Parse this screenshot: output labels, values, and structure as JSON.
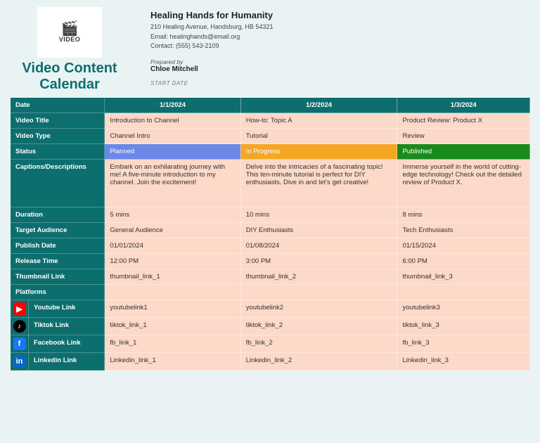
{
  "title_line1": "Video Content",
  "title_line2": "Calendar",
  "logo_word": "VIDEO",
  "org": {
    "name": "Healing Hands for Humanity",
    "address": "210 Healing Avenue, Handsburg, HB 54321",
    "email": "Email: healinghands@email.org",
    "contact": "Contact: (555) 543-2109"
  },
  "prepared_by_label": "Prepared by",
  "prepared_by": "Chloe Mitchell",
  "start_date_label": "START DATE",
  "labels": {
    "date": "Date",
    "video_title": "Video Title",
    "video_type": "Video Type",
    "status": "Status",
    "captions": "Captions/Descriptions",
    "duration": "Duration",
    "target": "Target Audience",
    "publish": "Publish Date",
    "release": "Release Time",
    "thumb": "Thumbnail Link",
    "platforms": "Platforms",
    "youtube": "Youtube Link",
    "tiktok": "Tiktok Link",
    "facebook": "Facebook Link",
    "linkedin": "Linkedin Link"
  },
  "cols": [
    {
      "date": "1/1/2024",
      "title": "Introduction to Channel",
      "type": "Channel Intro",
      "status": "Planned",
      "status_class": "planned",
      "caption": "Embark on an exhilarating journey with me! A five-minute introduction to my channel. Join the excitement!",
      "duration": "5 mins",
      "target": "General Audience",
      "publish": "01/01/2024",
      "release": "12:00 PM",
      "thumb": "thumbnail_link_1",
      "youtube": "youtubelink1",
      "tiktok": "tiktok_link_1",
      "facebook": "fb_link_1",
      "linkedin": "Linkedin_link_1"
    },
    {
      "date": "1/2/2024",
      "title": "How-to: Topic A",
      "type": "Tutorial",
      "status": "In Progress",
      "status_class": "inprogress",
      "caption": "Delve into the intricacies of a fascinating topic! This ten-minute tutorial is perfect for DIY enthusiasts. Dive in and let's get creative!",
      "duration": "10 mins",
      "target": "DIY Enthusiasts",
      "publish": "01/08/2024",
      "release": "3:00 PM",
      "thumb": "thumbnail_link_2",
      "youtube": "youtubelink2",
      "tiktok": "tiktok_link_2",
      "facebook": "fb_link_2",
      "linkedin": "Linkedin_link_2"
    },
    {
      "date": "1/3/2024",
      "title": "Product Review: Product X",
      "type": "Review",
      "status": "Published",
      "status_class": "published",
      "caption": "Immerse yourself in the world of cutting-edge technology! Check out the detailed review of Product X.",
      "duration": "8 mins",
      "target": "Tech Enthusiasts",
      "publish": "01/15/2024",
      "release": "6:00 PM",
      "thumb": "thumbnail_link_3",
      "youtube": "youtubelink3",
      "tiktok": "tiktok_link_3",
      "facebook": "fb_link_3",
      "linkedin": "Linkedin_link_3"
    }
  ]
}
